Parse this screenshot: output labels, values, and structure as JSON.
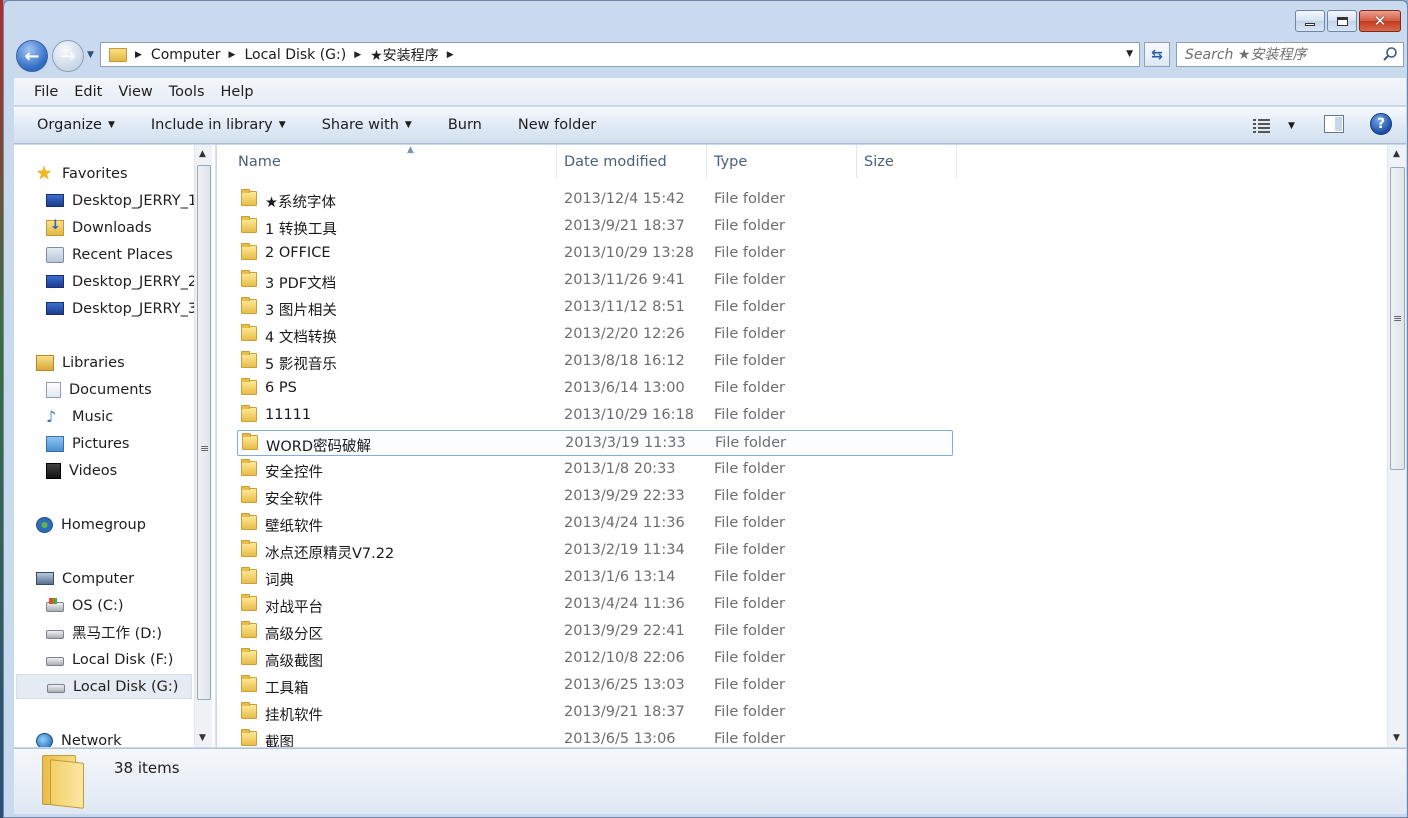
{
  "window": {
    "caption_buttons": [
      "minimize",
      "maximize",
      "close"
    ],
    "close_glyph": "✕"
  },
  "nav": {
    "back_glyph": "←",
    "forward_glyph": "→",
    "breadcrumbs": [
      "Computer",
      "Local Disk (G:)",
      "★安装程序"
    ],
    "search_placeholder": "Search ★安装程序"
  },
  "menu": [
    "File",
    "Edit",
    "View",
    "Tools",
    "Help"
  ],
  "commands": [
    {
      "label": "Organize",
      "dropdown": true
    },
    {
      "label": "Include in library",
      "dropdown": true
    },
    {
      "label": "Share with",
      "dropdown": true
    },
    {
      "label": "Burn",
      "dropdown": false
    },
    {
      "label": "New folder",
      "dropdown": false
    }
  ],
  "help_glyph": "?",
  "sidebar": {
    "groups": [
      {
        "label": "Favorites",
        "icon": "star-icon"
      },
      {
        "label": "Desktop_JERRY_1",
        "icon": "desktop-icon"
      },
      {
        "label": "Downloads",
        "icon": "downloads-icon"
      },
      {
        "label": "Recent Places",
        "icon": "recent-places-icon"
      },
      {
        "label": "Desktop_JERRY_2",
        "icon": "desktop-icon"
      },
      {
        "label": "Desktop_JERRY_3",
        "icon": "desktop-icon"
      },
      {
        "label": "Libraries",
        "icon": "libraries-icon"
      },
      {
        "label": "Documents",
        "icon": "documents-icon"
      },
      {
        "label": "Music",
        "icon": "music-icon"
      },
      {
        "label": "Pictures",
        "icon": "pictures-icon"
      },
      {
        "label": "Videos",
        "icon": "videos-icon"
      },
      {
        "label": "Homegroup",
        "icon": "homegroup-icon"
      },
      {
        "label": "Computer",
        "icon": "computer-icon"
      },
      {
        "label": "OS (C:)",
        "icon": "os-drive-icon"
      },
      {
        "label": "黑马工作 (D:)",
        "icon": "drive-icon"
      },
      {
        "label": "Local Disk (F:)",
        "icon": "drive-icon"
      },
      {
        "label": "Local Disk (G:)",
        "icon": "drive-icon",
        "selected": true
      },
      {
        "label": "Network",
        "icon": "network-icon"
      }
    ]
  },
  "columns": {
    "name": "Name",
    "date": "Date modified",
    "type": "Type",
    "size": "Size"
  },
  "files": [
    {
      "name": "★系统字体",
      "date": "2013/12/4 15:42",
      "type": "File folder"
    },
    {
      "name": "1 转换工具",
      "date": "2013/9/21 18:37",
      "type": "File folder"
    },
    {
      "name": "2 OFFICE",
      "date": "2013/10/29 13:28",
      "type": "File folder"
    },
    {
      "name": "3 PDF文档",
      "date": "2013/11/26 9:41",
      "type": "File folder"
    },
    {
      "name": "3 图片相关",
      "date": "2013/11/12 8:51",
      "type": "File folder"
    },
    {
      "name": "4 文档转换",
      "date": "2013/2/20 12:26",
      "type": "File folder"
    },
    {
      "name": "5 影视音乐",
      "date": "2013/8/18 16:12",
      "type": "File folder"
    },
    {
      "name": "6 PS",
      "date": "2013/6/14 13:00",
      "type": "File folder"
    },
    {
      "name": "11111",
      "date": "2013/10/29 16:18",
      "type": "File folder"
    },
    {
      "name": "WORD密码破解",
      "date": "2013/3/19 11:33",
      "type": "File folder",
      "selected": true
    },
    {
      "name": "安全控件",
      "date": "2013/1/8 20:33",
      "type": "File folder"
    },
    {
      "name": "安全软件",
      "date": "2013/9/29 22:33",
      "type": "File folder"
    },
    {
      "name": "壁纸软件",
      "date": "2013/4/24 11:36",
      "type": "File folder"
    },
    {
      "name": "冰点还原精灵V7.22",
      "date": "2013/2/19 11:34",
      "type": "File folder"
    },
    {
      "name": "词典",
      "date": "2013/1/6 13:14",
      "type": "File folder"
    },
    {
      "name": "对战平台",
      "date": "2013/4/24 11:36",
      "type": "File folder"
    },
    {
      "name": "高级分区",
      "date": "2013/9/29 22:41",
      "type": "File folder"
    },
    {
      "name": "高级截图",
      "date": "2012/10/8 22:06",
      "type": "File folder"
    },
    {
      "name": "工具箱",
      "date": "2013/6/25 13:03",
      "type": "File folder"
    },
    {
      "name": "挂机软件",
      "date": "2013/9/21 18:37",
      "type": "File folder"
    },
    {
      "name": "截图",
      "date": "2013/6/5 13:06",
      "type": "File folder"
    }
  ],
  "status": {
    "item_count": "38 items"
  }
}
